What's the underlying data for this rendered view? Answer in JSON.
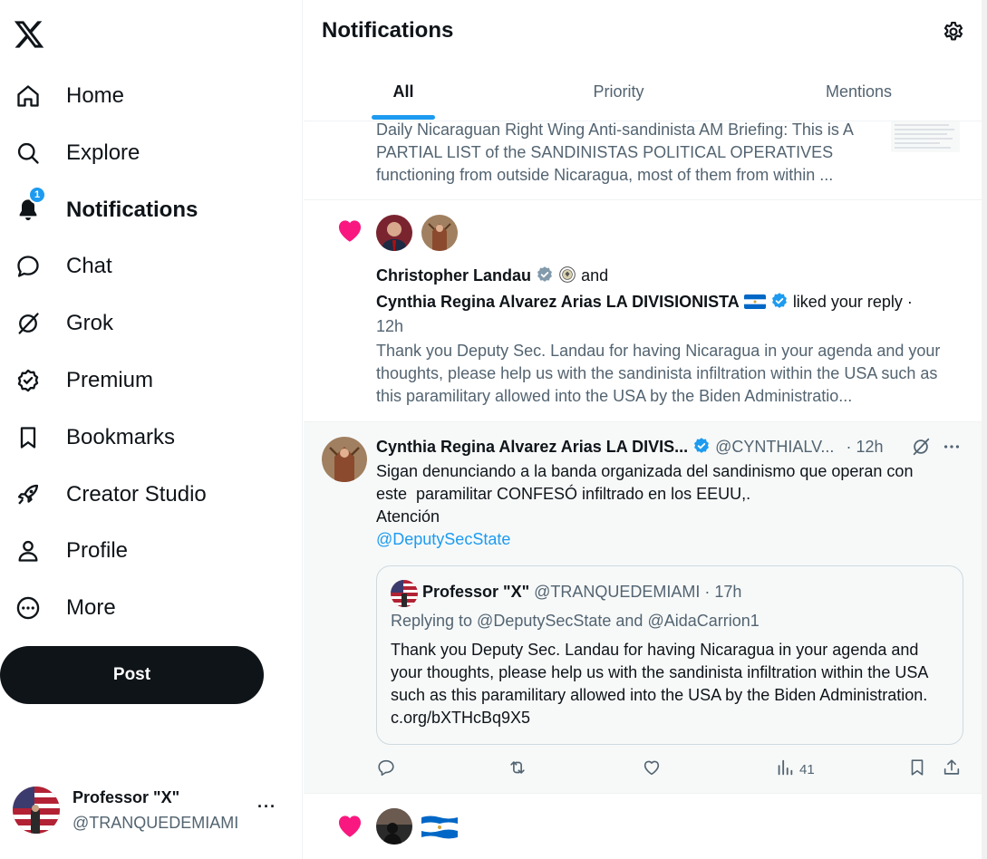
{
  "sidebar": {
    "logo": "x-logo-icon",
    "items": [
      {
        "label": "Home",
        "icon": "home-icon"
      },
      {
        "label": "Explore",
        "icon": "search-icon"
      },
      {
        "label": "Notifications",
        "icon": "bell-icon",
        "badge": "1"
      },
      {
        "label": "Chat",
        "icon": "chat-bubble-icon"
      },
      {
        "label": "Grok",
        "icon": "grok-icon"
      },
      {
        "label": "Premium",
        "icon": "verified-badge-icon"
      },
      {
        "label": "Bookmarks",
        "icon": "bookmark-icon"
      },
      {
        "label": "Creator Studio",
        "icon": "rocket-icon"
      },
      {
        "label": "Profile",
        "icon": "person-icon"
      },
      {
        "label": "More",
        "icon": "more-circle-icon"
      }
    ],
    "post_label": "Post",
    "account": {
      "name": "Professor \"X\"",
      "handle": "@TRANQUEDEMIAMI",
      "more": "···"
    }
  },
  "header": {
    "title": "Notifications",
    "tabs": [
      {
        "label": "All",
        "active": true
      },
      {
        "label": "Priority",
        "active": false
      },
      {
        "label": "Mentions",
        "active": false
      }
    ]
  },
  "notifications": {
    "n1": {
      "text": "Daily Nicaraguan Right Wing Anti-sandinista AM Briefing: This is A PARTIAL LIST of the SANDINISTAS POLITICAL OPERATIVES functioning from outside Nicaragua, most of them from within ..."
    },
    "n2": {
      "user1": "Christopher Landau",
      "and": "and",
      "user2": "Cynthia Regina Alvarez Arias LA DIVISIONISTA",
      "action": "liked your reply ·",
      "time": "12h",
      "text": "Thank you Deputy Sec. Landau for having Nicaragua in your agenda and your thoughts, please help us with the sandinista infiltration within the USA such as this paramilitary allowed into the USA by the Biden Administratio..."
    },
    "n3": {
      "name": "Cynthia Regina Alvarez Arias LA DIVIS...",
      "handle": "@CYNTHIALV...",
      "time": "· 12h",
      "line1": "Sigan denunciando a la banda organizada del sandinismo que operan con",
      "line2": "este  paramilitar CONFESÓ infiltrado en los EEUU,.",
      "line3": "Atención",
      "mention": "@DeputySecState",
      "quote": {
        "name": "Professor \"X\"",
        "handle": "@TRANQUEDEMIAMI · 17h",
        "replying": "Replying to @DeputySecState and @AidaCarrion1",
        "text": "Thank you Deputy Sec. Landau for having Nicaragua in your agenda and your thoughts, please help us with the sandinista infiltration within the USA such as this paramilitary allowed into the USA by the Biden Administration. c.org/bXTHcBq9X5"
      },
      "views": "41"
    }
  },
  "colors": {
    "accent": "#1d9bf0",
    "heart": "#f91880",
    "text": "#0f1419",
    "muted": "#536471"
  }
}
